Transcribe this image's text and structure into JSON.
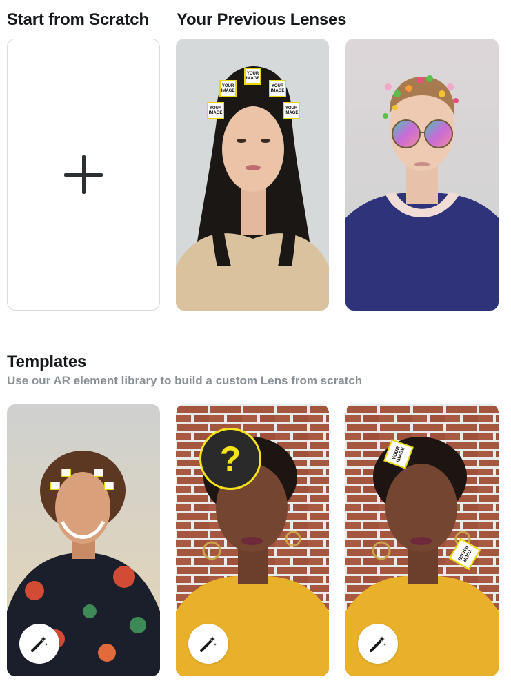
{
  "headers": {
    "scratch": "Start from Scratch",
    "previous": "Your Previous Lenses",
    "templates": "Templates",
    "templates_sub": "Use our AR element library to build a custom Lens from scratch"
  },
  "stickers": {
    "your_image": "YOUR IMAGE",
    "question": "?"
  },
  "icons": {
    "add": "plus-icon",
    "template": "magic-wand-icon"
  },
  "colors": {
    "accent_yellow": "#f4e21b",
    "title": "#16191c",
    "subtitle": "#8a9196",
    "card_border": "#d9dcdf"
  }
}
